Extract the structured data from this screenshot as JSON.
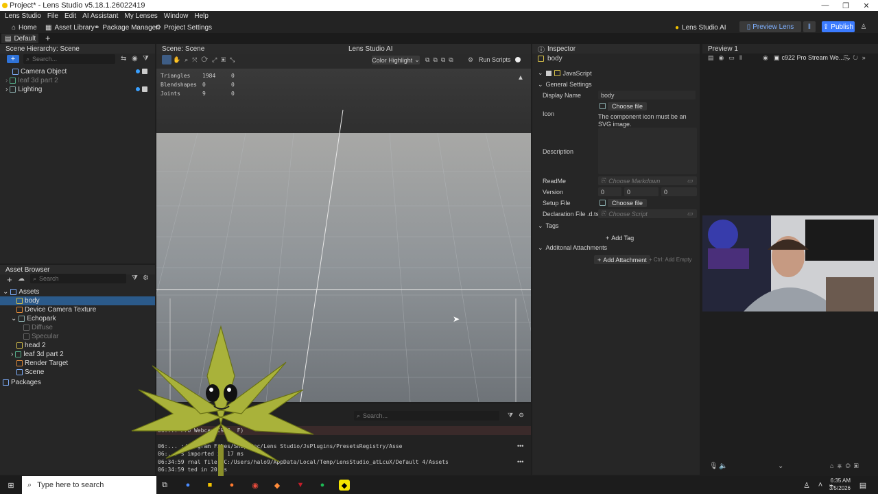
{
  "window": {
    "title": "Project* - Lens Studio v5.18.1.26022419",
    "minimize": "—",
    "restore": "❐",
    "close": "✕"
  },
  "menu": [
    "Lens Studio",
    "File",
    "Edit",
    "AI Assistant",
    "My Lenses",
    "Window",
    "Help"
  ],
  "toolbar": {
    "home": "Home",
    "asset_library": "Asset Library",
    "package_manager": "Package Manager",
    "project_settings": "Project Settings",
    "ai": "Lens Studio AI",
    "preview_lens": "Preview Lens",
    "publish": "Publish"
  },
  "tabs": {
    "layout": "Default"
  },
  "scene_hierarchy": {
    "title": "Scene Hierarchy: Scene",
    "search_placeholder": "Search...",
    "items": [
      {
        "label": "Camera Object",
        "dim": false
      },
      {
        "label": "leaf 3d part 2",
        "dim": true
      },
      {
        "label": "Lighting",
        "dim": false
      }
    ]
  },
  "asset_browser": {
    "title": "Asset Browser",
    "search_placeholder": "Search",
    "items": [
      {
        "label": "Assets"
      },
      {
        "label": "body"
      },
      {
        "label": "Device Camera Texture"
      },
      {
        "label": "Echopark"
      },
      {
        "label": "Diffuse"
      },
      {
        "label": "Specular"
      },
      {
        "label": "head 2"
      },
      {
        "label": "leaf 3d part 2"
      },
      {
        "label": "Render Target"
      },
      {
        "label": "Scene"
      },
      {
        "label": "Packages"
      }
    ]
  },
  "scene": {
    "title": "Scene: Scene",
    "ai_tab": "Lens Studio AI",
    "color_highlight": "Color Highlight",
    "run_scripts": "Run Scripts",
    "stats": [
      {
        "label": "Triangles",
        "value": "1984",
        "extra": "0"
      },
      {
        "label": "Blendshapes",
        "value": "0",
        "extra": "0"
      },
      {
        "label": "Joints",
        "value": "9",
        "extra": "0"
      }
    ]
  },
  "console": {
    "search_placeholder": "Search...",
    "lines": [
      "06:...        Pro Webcam C920, F)",
      "06:...        :/Program Files/Snap Inc/Lens Studio/JsPlugins/PresetsRegistry/Asse",
      "06:...        s imported in 17 ms",
      "06:34:59      rnal file: C:/Users/halo9/AppData/Local/Temp/LensStudio_atLcuX/Default 4/Assets",
      "06:34:59      ted in 20 ms"
    ]
  },
  "inspector": {
    "title": "Inspector",
    "object": "body",
    "component": "JavaScript",
    "section_general": "General Settings",
    "display_name_label": "Display Name",
    "display_name_value": "body",
    "choose_file": "Choose file",
    "icon_label": "Icon",
    "icon_note": "The component icon must be an SVG image.",
    "description_label": "Description",
    "readme_label": "ReadMe",
    "readme_placeholder": "Choose Markdown",
    "version_label": "Version",
    "version": [
      "0",
      "0",
      "0"
    ],
    "setup_file_label": "Setup File",
    "setup_choose": "Choose file",
    "declaration_label": "Declaration File .d.ts",
    "declaration_placeholder": "Choose Script",
    "tags_label": "Tags",
    "add_tag": "Add Tag",
    "attachments_label": "Additonal Attachments",
    "add_attachment": "Add Attachment",
    "ctrl_add_empty": "+ Ctrl: Add Empty"
  },
  "preview": {
    "title": "Preview 1",
    "camera": "c922 Pro Stream We..."
  },
  "taskbar": {
    "search_placeholder": "Type here to search",
    "time": "6:35 AM",
    "date": "3/5/2026"
  },
  "colors": {
    "accent": "#2f73d9",
    "selection": "#2b5a8a",
    "publish": "#3b7bff"
  }
}
